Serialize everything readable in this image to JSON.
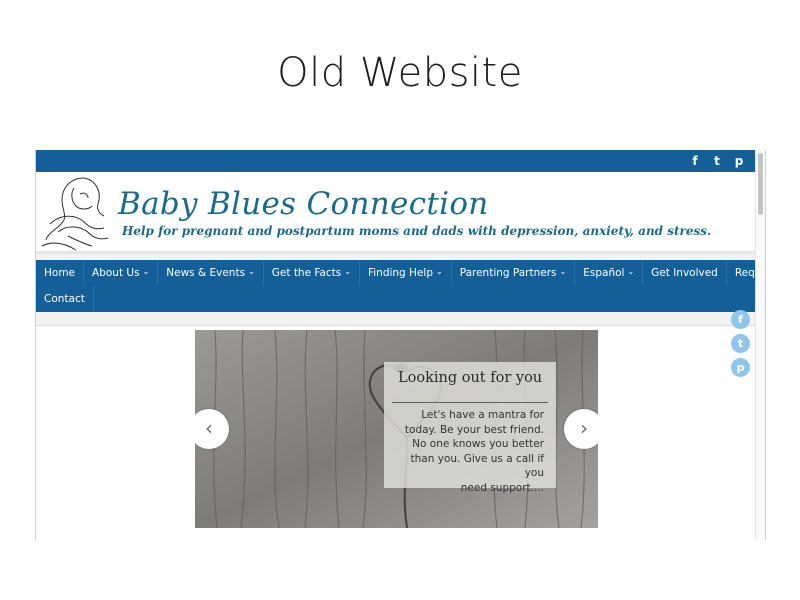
{
  "page": {
    "heading": "Old Website"
  },
  "top_social": {
    "items": [
      "f",
      "t",
      "p"
    ]
  },
  "header": {
    "title": "Baby Blues Connection",
    "tagline": "Help for pregnant and postpartum moms and dads with depression, anxiety, and stress."
  },
  "nav": {
    "row1": [
      {
        "label": "Home",
        "dropdown": false
      },
      {
        "label": "About Us",
        "dropdown": true
      },
      {
        "label": "News & Events",
        "dropdown": true
      },
      {
        "label": "Get the Facts",
        "dropdown": true
      },
      {
        "label": "Finding Help",
        "dropdown": true
      },
      {
        "label": "Parenting Partners",
        "dropdown": true
      },
      {
        "label": "Español",
        "dropdown": true
      },
      {
        "label": "Get Involved",
        "dropdown": false
      },
      {
        "label": "Request a Speaker",
        "dropdown": false
      }
    ],
    "row2": [
      {
        "label": "Contact",
        "dropdown": false
      }
    ],
    "caret": "⌄"
  },
  "float_social": {
    "items": [
      "f",
      "t",
      "p"
    ]
  },
  "slider": {
    "title": "Looking out for you",
    "text_lines": [
      "Let's have a mantra for",
      "today. Be your best friend.",
      "No one knows you better",
      "than you. Give us a call if you",
      "need support...."
    ],
    "prev": "‹",
    "next": "›"
  },
  "colors": {
    "nav_blue": "#155f98",
    "title_teal": "#1a6a8a",
    "social_light_blue": "#8fc7ea"
  }
}
